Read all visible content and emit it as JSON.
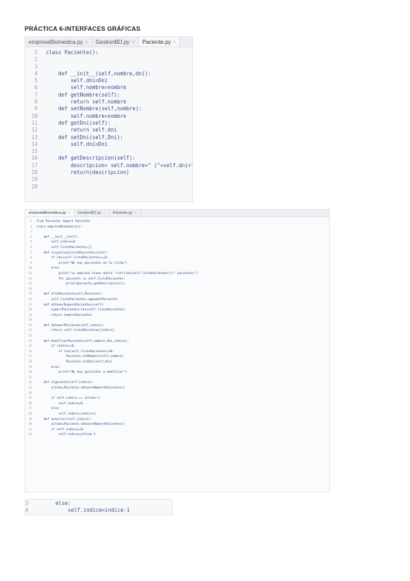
{
  "title": "PRÁCTICA 6-INTERFACES GRÁFICAS",
  "screenshot1": {
    "tabs": [
      {
        "label": "empresaBiomedica.py",
        "active": false
      },
      {
        "label": "GestionBD.py",
        "active": false
      },
      {
        "label": "Paciente.py",
        "active": true
      }
    ],
    "lines": [
      {
        "n": "1",
        "code": "class Paciente():"
      },
      {
        "n": "2",
        "code": ""
      },
      {
        "n": "3",
        "code": ""
      },
      {
        "n": "4",
        "code": "    def __init__(self,nombre,dni):"
      },
      {
        "n": "5",
        "code": "        self.dni=Dni"
      },
      {
        "n": "6",
        "code": "        self.nombre=nombre"
      },
      {
        "n": "7",
        "code": "    def getNombre(self):"
      },
      {
        "n": "8",
        "code": "        return self.nombre"
      },
      {
        "n": "9",
        "code": "    def setNombre(self,nombre):"
      },
      {
        "n": "10",
        "code": "        self.nombre=nombre"
      },
      {
        "n": "11",
        "code": "    def getDni(self):"
      },
      {
        "n": "12",
        "code": "        return self.dni"
      },
      {
        "n": "13",
        "code": "    def setDni(self,Dni):"
      },
      {
        "n": "14",
        "code": "        self.dni=Dni"
      },
      {
        "n": "15",
        "code": ""
      },
      {
        "n": "16",
        "code": "    def getDescripcion(self):"
      },
      {
        "n": "17",
        "code": "        descripcion= self.nombre+\" (\"+self.dni+\")\""
      },
      {
        "n": "18",
        "code": "        return(descripcion)"
      },
      {
        "n": "19",
        "code": ""
      },
      {
        "n": "20",
        "code": ""
      }
    ]
  },
  "screenshot2": {
    "tabs": [
      {
        "label": "empresaBiomedica.py",
        "active": true
      },
      {
        "label": "GestionBD.py",
        "active": false
      },
      {
        "label": "Paciente.py",
        "active": false
      }
    ],
    "lines": [
      {
        "n": "1",
        "code": "from Paciente import Paciente"
      },
      {
        "n": "2",
        "code": "class empresaBiomedica():"
      },
      {
        "n": "3",
        "code": ""
      },
      {
        "n": "4",
        "code": "    def __init__(self):"
      },
      {
        "n": "5",
        "code": "        self.indice=0"
      },
      {
        "n": "6",
        "code": "        self.listaPacientes=[]"
      },
      {
        "n": "7",
        "code": "    def visualizarListaPacientes(self):"
      },
      {
        "n": "8",
        "code": "        if len(self.listaPacientes)==0:"
      },
      {
        "n": "9",
        "code": "            print(\"No hay pacientes en la lista\")"
      },
      {
        "n": "10",
        "code": "        else:"
      },
      {
        "n": "11",
        "code": "            print(\"La empresa tiene ahora \"+str(len(self.listaPacientes))+\" pacientes\")"
      },
      {
        "n": "12",
        "code": "            for paciente in self.listaPacientes:"
      },
      {
        "n": "13",
        "code": "                print(paciente.getDescripcion())"
      },
      {
        "n": "14",
        "code": ""
      },
      {
        "n": "15",
        "code": "    def altaPaciente(self,Paciente):"
      },
      {
        "n": "16",
        "code": "        self.listaPacientes.append(Paciente)"
      },
      {
        "n": "17",
        "code": "    def obtenerNumeroPacientes(self):"
      },
      {
        "n": "18",
        "code": "        numeroPacientes=len(self.listaPacientes)"
      },
      {
        "n": "19",
        "code": "        return numeroPacientes"
      },
      {
        "n": "20",
        "code": ""
      },
      {
        "n": "21",
        "code": "    def obtenerPaciente(self,indice):"
      },
      {
        "n": "22",
        "code": "        return self.listaPacientes[indice]"
      },
      {
        "n": "23",
        "code": ""
      },
      {
        "n": "24",
        "code": "    def modificarPaciente(self,nombre,dni,indice):"
      },
      {
        "n": "25",
        "code": "        if indice>=0:"
      },
      {
        "n": "26",
        "code": "            if len(self.listaPacientes)>0:"
      },
      {
        "n": "27",
        "code": "                Paciente.setNombre(self,nombre)"
      },
      {
        "n": "28",
        "code": "                Paciente.setDni(self,dni)"
      },
      {
        "n": "29",
        "code": "        else:"
      },
      {
        "n": "30",
        "code": "            print(\"No hay pacientes a modificar\")"
      },
      {
        "n": "31",
        "code": ""
      },
      {
        "n": "32",
        "code": "    def siguiente(self,indice):"
      },
      {
        "n": "33",
        "code": "        ultimo=Paciente.obtenerNumeroPacientes()"
      },
      {
        "n": "34",
        "code": ""
      },
      {
        "n": "35",
        "code": "        if self.indice == ultimo-1:"
      },
      {
        "n": "36",
        "code": "            self.indice=0"
      },
      {
        "n": "37",
        "code": "        else:"
      },
      {
        "n": "38",
        "code": "            self.indice=indice+1"
      },
      {
        "n": "39",
        "code": "    def anterior(self,indice):"
      },
      {
        "n": "40",
        "code": "        ultimo=Paciente.obtenerNumeroPacientes()"
      },
      {
        "n": "41",
        "code": "        if self.indice==0:"
      },
      {
        "n": "42",
        "code": "            self.indice=ultimo-1"
      }
    ]
  },
  "screenshot3": {
    "lines": [
      {
        "n": "3",
        "code": "else:"
      },
      {
        "n": "4",
        "code": "    self.indice=indice-1"
      }
    ]
  }
}
